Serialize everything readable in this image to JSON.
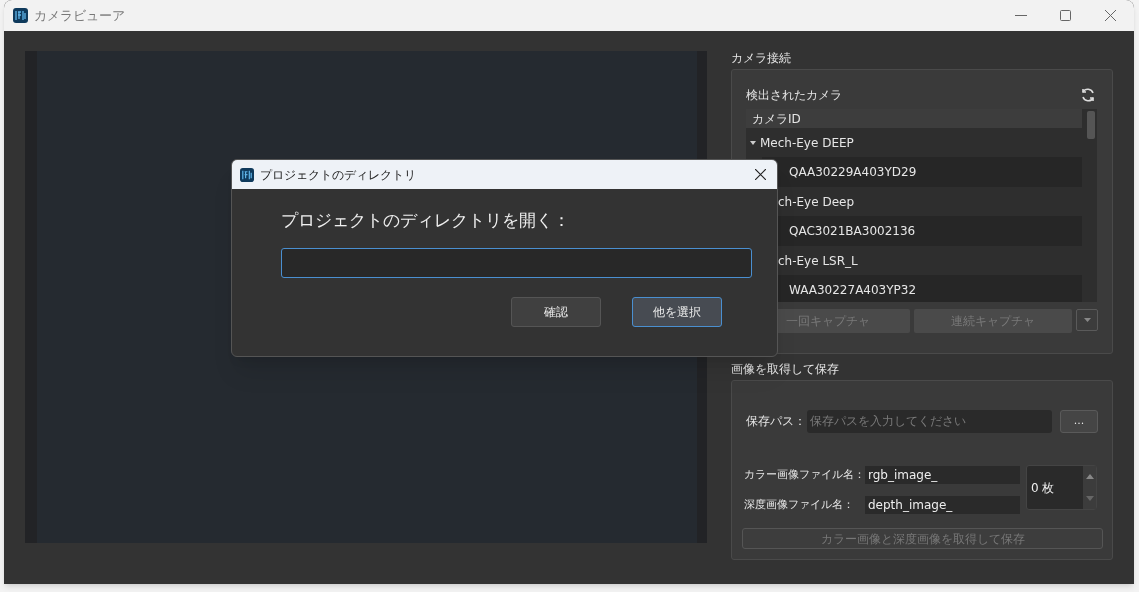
{
  "window": {
    "title": "カメラビューア"
  },
  "camera_connection": {
    "title": "カメラ接続",
    "detected_label": "検出されたカメラ",
    "tree": {
      "header": "カメラID",
      "groups": [
        {
          "label": "Mech-Eye DEEP",
          "expanded": true,
          "clipped": false,
          "children": [
            {
              "label": "QAA30229A403YD29"
            }
          ]
        },
        {
          "label": "ch-Eye Deep",
          "expanded": true,
          "clipped": true,
          "children": [
            {
              "label": "QAC3021BA3002136"
            }
          ]
        },
        {
          "label": "ch-Eye LSR_L",
          "expanded": true,
          "clipped": true,
          "children": [
            {
              "label": "WAA30227A403YP32"
            }
          ]
        }
      ]
    },
    "buttons": [
      {
        "label": "一回キャプチャ",
        "disabled": true
      },
      {
        "label": "連続キャプチャ",
        "disabled": true
      }
    ]
  },
  "save": {
    "title": "画像を取得して保存",
    "path_label": "保存パス：",
    "path_placeholder": "保存パスを入力してください",
    "browse_label": "...",
    "color_label": "カラー画像ファイル名：",
    "color_value": "rgb_image_",
    "depth_label": "深度画像ファイル名：",
    "depth_value": "depth_image_",
    "count": "0 枚",
    "save_button": {
      "label": "カラー画像と深度画像を取得して保存",
      "disabled": true
    }
  },
  "dialog": {
    "title": "プロジェクトのディレクトリ",
    "prompt": "プロジェクトのディレクトリを開く：",
    "buttons": [
      {
        "label": "確認",
        "selected": false
      },
      {
        "label": "他を選択",
        "selected": true
      }
    ]
  }
}
